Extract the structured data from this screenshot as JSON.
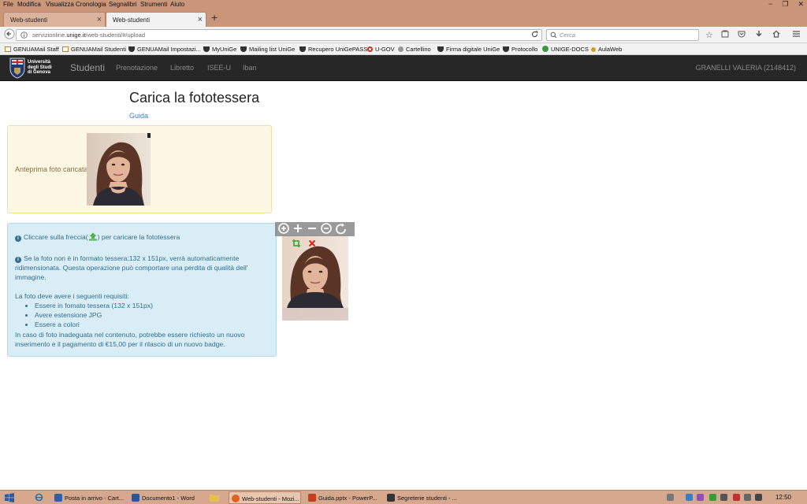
{
  "menubar": {
    "items": [
      "File",
      "Modifica",
      "Visualizza",
      "Cronologia",
      "Segnalibri",
      "Strumenti",
      "Aiuto"
    ],
    "window_controls": [
      "−",
      "❐",
      "✕"
    ]
  },
  "tabs": [
    {
      "label": "Web-studenti"
    },
    {
      "label": "Web-studenti"
    }
  ],
  "new_tab_glyph": "+",
  "navbar": {
    "url_prefix": "servizionline.",
    "url_domain": "unige.it",
    "url_path": "/web-studenti/#/upload",
    "search_placeholder": "Cerca"
  },
  "bookmarks": [
    {
      "label": "GENUAMail Staff",
      "color": "#c08030"
    },
    {
      "label": "GENUAMail Studenti",
      "color": "#c08030"
    },
    {
      "label": "GENUAMail Impostazi...",
      "color": "#333333"
    },
    {
      "label": "MyUniGe",
      "color": "#333333"
    },
    {
      "label": "Mailing list UniGe",
      "color": "#333333"
    },
    {
      "label": "Recupero UniGePASS",
      "color": "#333333"
    },
    {
      "label": "U-GOV",
      "color": "#d03020"
    },
    {
      "label": "Cartellino",
      "color": "#777777"
    },
    {
      "label": "Firma digitale UniGe",
      "color": "#333333"
    },
    {
      "label": "Protocollo",
      "color": "#333333"
    },
    {
      "label": "UNIGE-DOCS",
      "color": "#3a9a3a"
    },
    {
      "label": "AulaWeb",
      "color": "#d0a020"
    }
  ],
  "app": {
    "logo_lines": [
      "Università",
      "degli Studi",
      "di Genova"
    ],
    "brand": "Studenti",
    "nav": [
      "Prenotazione",
      "Libretto",
      "ISEE-U",
      "Iban"
    ],
    "user": "GRANELLI VALERIA (2148412)"
  },
  "page": {
    "title": "Carica la fototessera",
    "guide_link": "Guida",
    "preview_label": "Anteprima foto caricata"
  },
  "info": {
    "line1_before": "Cliccare sulla freccia(",
    "line1_after": ") per caricare la fototessera",
    "line2": "Se la foto non è in formato tessera:132 x 151px, verrà automaticamente",
    "line3": "ridimensionata. Questa operazione può comportare una perdita di qualità dell'",
    "line4": "immagine.",
    "requirements_title": "La foto deve avere i seguenti requisiti:",
    "requirements": [
      "Essere in fomato tessera (132 x 151px)",
      "Avere estensione JPG",
      "Essere a colori"
    ],
    "footer1": "In caso di foto inadeguata nel contenuto, potrebbe essere richiesto un nuovo",
    "footer2": "inserimento e il pagamento di €15,00 per il rilascio di un nuovo badge."
  },
  "editor_tools": [
    "zoom-in-icon",
    "plus-icon",
    "minus-icon",
    "zoom-out-icon",
    "rotate-icon",
    "crop-icon",
    "delete-icon"
  ],
  "taskbar": {
    "tasks": [
      {
        "label": "Posta in arrivo - Cart...",
        "color": "#3060a0"
      },
      {
        "label": "Documento1 - Word",
        "color": "#2b579a"
      },
      {
        "label": "Web-studenti - Mozi...",
        "color": "#e06020"
      },
      {
        "label": "Guida.pptx - PowerP...",
        "color": "#c43e1c"
      },
      {
        "label": "Segreterie studenti - ...",
        "color": "#333333"
      }
    ],
    "clock": "12:50"
  },
  "colors": {
    "chrome": "#c9967a",
    "navbar_dark": "#272727",
    "warning_bg": "#fcf8e3",
    "info_bg": "#d9edf7",
    "info_text": "#31708f",
    "link": "#3a7ec2"
  }
}
